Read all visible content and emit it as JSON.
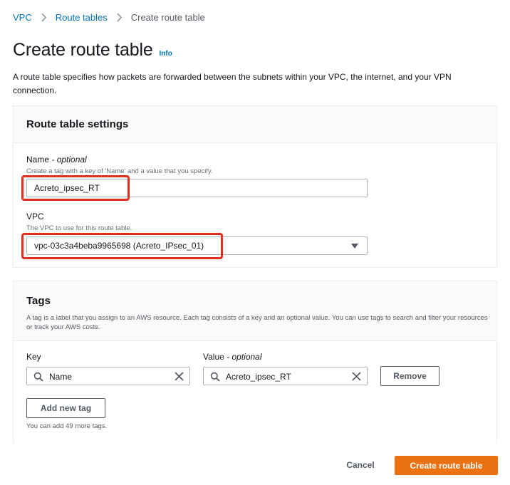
{
  "breadcrumb": {
    "items": [
      "VPC",
      "Route tables"
    ],
    "current": "Create route table"
  },
  "page": {
    "title": "Create route table",
    "info": "Info",
    "description": "A route table specifies how packets are forwarded between the subnets within your VPC, the internet, and your VPN connection."
  },
  "settings": {
    "title": "Route table settings",
    "name_label": "Name",
    "name_optional": "- optional",
    "name_desc": "Create a tag with a key of 'Name' and a value that you specify.",
    "name_value": "Acreto_ipsec_RT",
    "vpc_label": "VPC",
    "vpc_desc": "The VPC to use for this route table.",
    "vpc_value": "vpc-03c3a4beba9965698 (Acreto_IPsec_01)"
  },
  "tags": {
    "title": "Tags",
    "description": "A tag is a label that you assign to an AWS resource. Each tag consists of a key and an optional value. You can use tags to search and filter your resources or track your AWS costs.",
    "key_label": "Key",
    "value_label": "Value",
    "value_optional": "- optional",
    "rows": [
      {
        "key": "Name",
        "value": "Acreto_ipsec_RT"
      }
    ],
    "remove_label": "Remove",
    "add_label": "Add new tag",
    "helper": "You can add 49 more tags."
  },
  "footer": {
    "cancel_label": "Cancel",
    "create_label": "Create route table"
  },
  "colors": {
    "link": "#0073bb",
    "primary": "#ec7211",
    "highlight": "#e0301e"
  }
}
